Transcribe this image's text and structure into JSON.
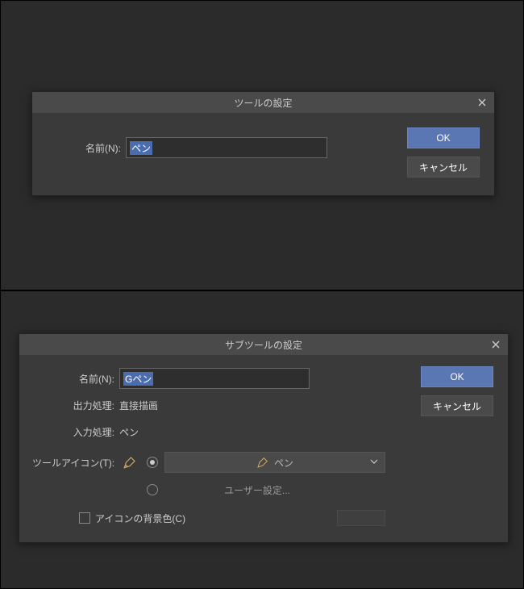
{
  "dialog1": {
    "title": "ツールの設定",
    "name_label": "名前(N):",
    "name_value": "ペン",
    "ok": "OK",
    "cancel": "キャンセル"
  },
  "dialog2": {
    "title": "サブツールの設定",
    "name_label": "名前(N):",
    "name_value": "Gペン",
    "output_label": "出力処理:",
    "output_value": "直接描画",
    "input_label": "入力処理:",
    "input_value": "ペン",
    "tool_icon_label": "ツールアイコン(T):",
    "dropdown_value": "ペン",
    "user_setting": "ユーザー設定...",
    "bg_color_label": "アイコンの背景色(C)",
    "ok": "OK",
    "cancel": "キャンセル"
  }
}
